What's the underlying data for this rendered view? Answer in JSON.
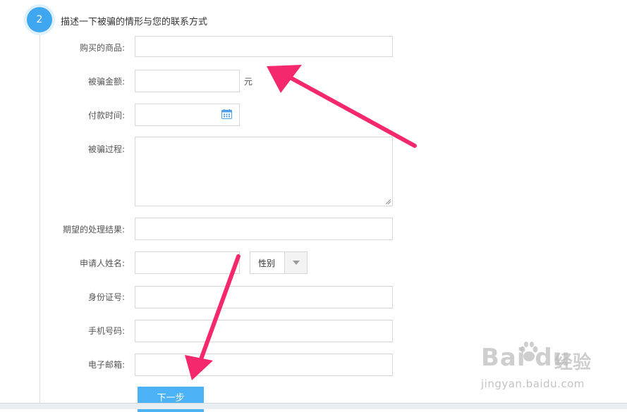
{
  "step": {
    "number": "2",
    "title": "描述一下被骗的情形与您的联系方式"
  },
  "form": {
    "goods_label": "购买的商品:",
    "amount_label": "被骗金额:",
    "amount_unit": "元",
    "pay_time_label": "付款时间:",
    "process_label": "被骗过程:",
    "expected_label": "期望的处理结果:",
    "name_label": "申请人姓名:",
    "gender_selected": "性别",
    "id_label": "身份证号:",
    "phone_label": "手机号码:",
    "email_label": "电子邮箱:"
  },
  "next_button": "下一步",
  "watermark": {
    "logo": "Bai du",
    "brand_cn": "经验",
    "url": "jingyan.baidu.com"
  },
  "colors": {
    "accent": "#3fa7f0",
    "arrow": "#f5286e"
  }
}
